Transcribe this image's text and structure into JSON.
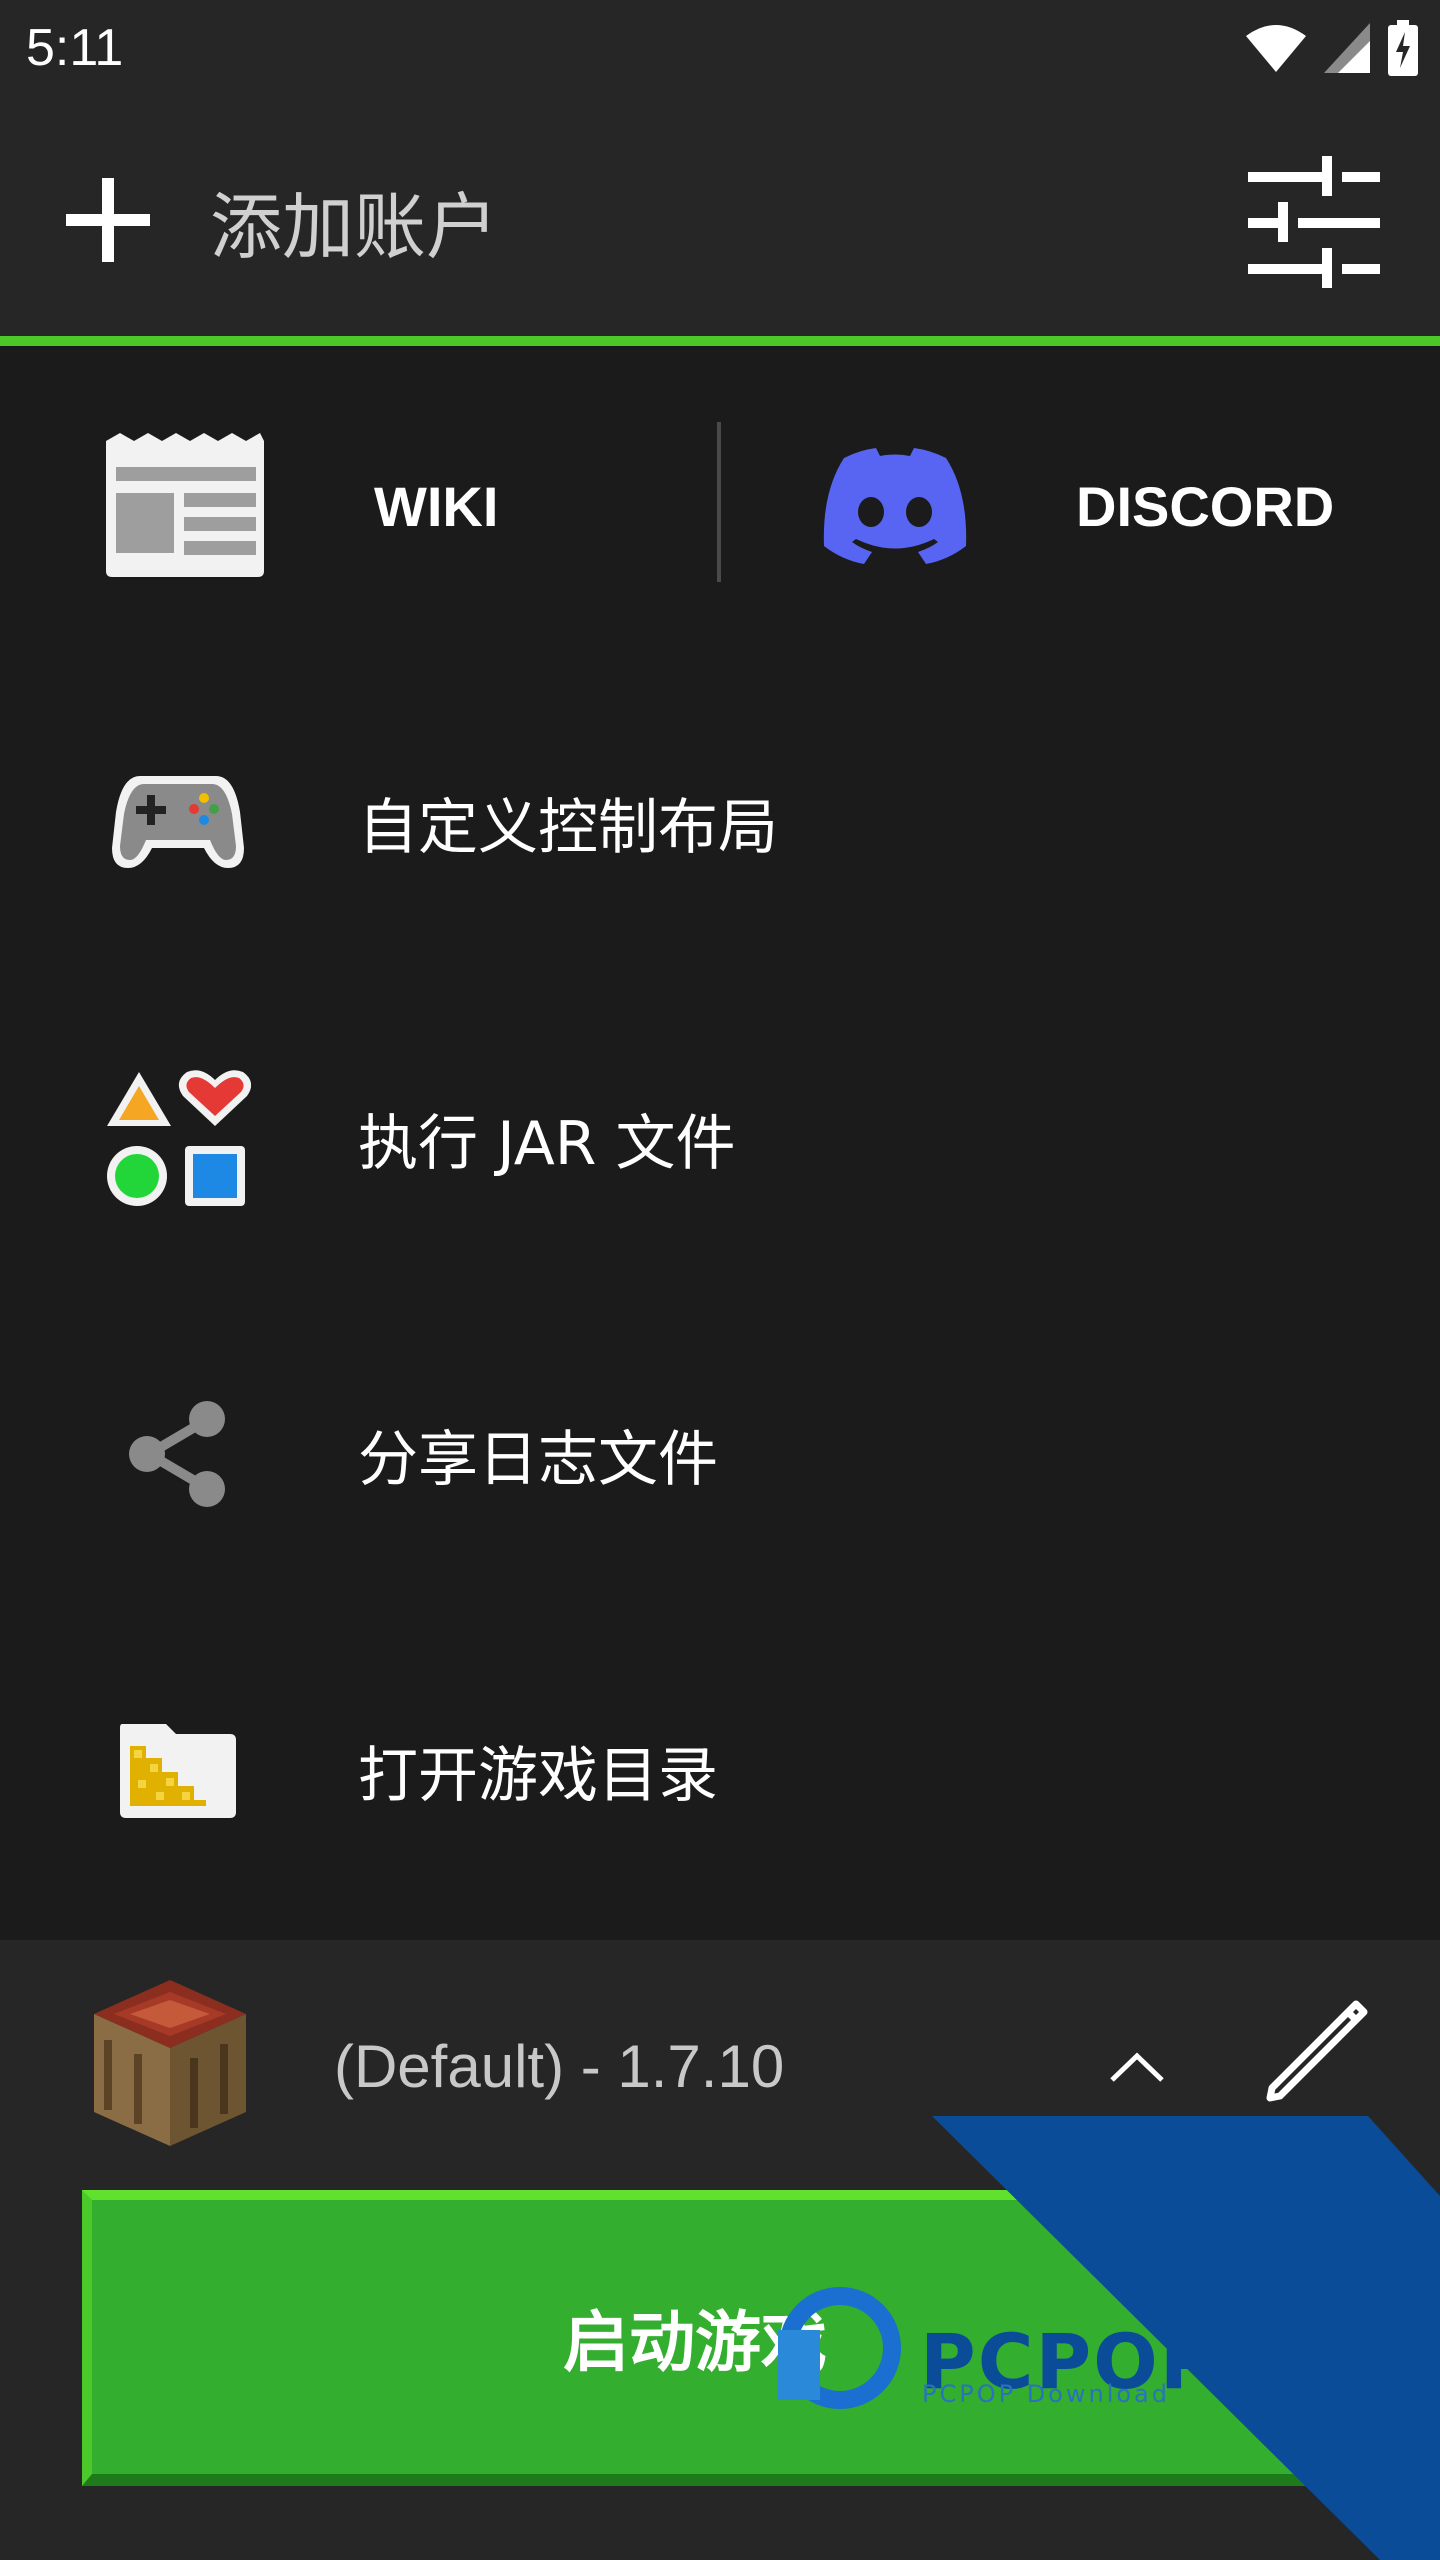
{
  "status_bar": {
    "time": "5:11",
    "icons": [
      "wifi-icon",
      "signal-icon",
      "battery-charging-icon"
    ]
  },
  "top_bar": {
    "add_account_label": "添加账户",
    "add_icon": "plus-icon",
    "settings_icon": "sliders-icon"
  },
  "colors": {
    "accent": "#4cc928",
    "discord": "#5865f2",
    "launch": "#33ae2f",
    "watermark_blue": "#0b4c98"
  },
  "quick_links": [
    {
      "label": "WIKI",
      "icon": "newspaper-icon"
    },
    {
      "label": "DISCORD",
      "icon": "discord-icon"
    }
  ],
  "menu": [
    {
      "label": "自定义控制布局",
      "icon": "gamepad-icon"
    },
    {
      "label": "执行 JAR 文件",
      "icon": "shapes-icon"
    },
    {
      "label": "分享日志文件",
      "icon": "share-icon"
    },
    {
      "label": "打开游戏目录",
      "icon": "folder-icon"
    }
  ],
  "profile": {
    "name": "(Default) - 1.7.10",
    "icon": "crafting-table-icon",
    "expand_icon": "chevron-up-icon",
    "edit_icon": "pencil-icon"
  },
  "launch": {
    "label": "启动游戏"
  },
  "watermark": {
    "text": "PCPOP下载",
    "subtext": "PCPOP Download"
  }
}
